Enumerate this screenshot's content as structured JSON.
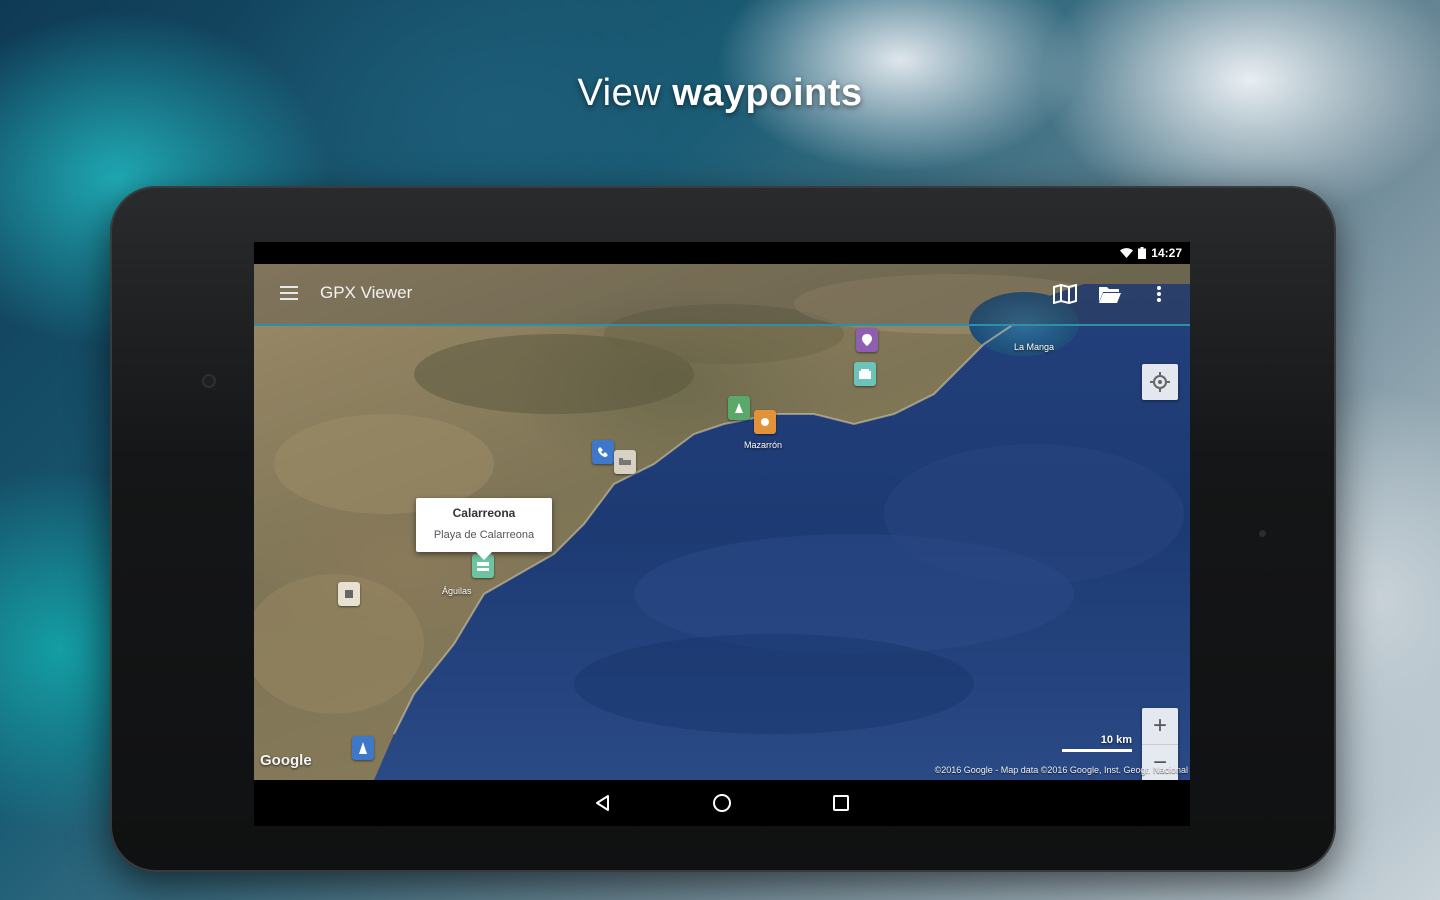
{
  "headline": {
    "light": "View",
    "bold": "waypoints"
  },
  "status_bar": {
    "time": "14:27"
  },
  "app_bar": {
    "title": "GPX Viewer"
  },
  "map": {
    "info_window": {
      "title": "Calarreona",
      "subtitle": "Playa de Calarreona"
    },
    "labels": [
      "La Manga",
      "Mazarrón",
      "Águilas"
    ],
    "google_logo": "Google",
    "scale": "10 km",
    "attribution": "©2016 Google - Map data ©2016 Google, Inst. Geogr. Nacional",
    "zoom_in": "+",
    "zoom_out": "−"
  },
  "colors": {
    "accent": "#2d8fa8",
    "sea": "#1d3a73",
    "land": "#8a7a5a"
  }
}
